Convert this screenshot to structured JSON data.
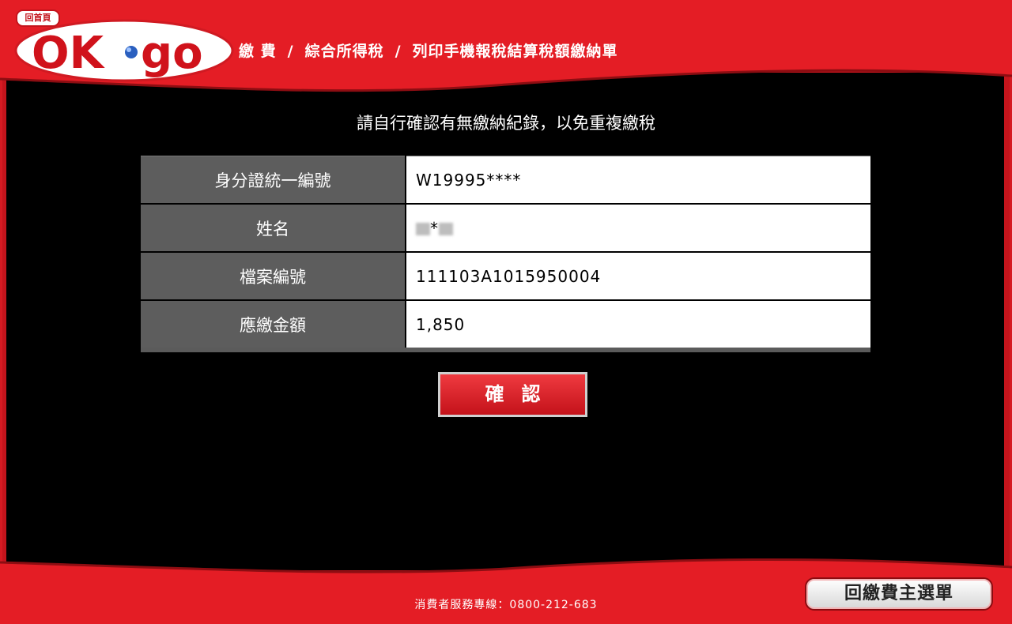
{
  "header": {
    "home_badge": "回首頁",
    "logo_text_left": "OK",
    "logo_text_right": "go",
    "breadcrumb": [
      "繳 費",
      "綜合所得稅",
      "列印手機報稅結算稅額繳納單"
    ],
    "breadcrumb_separator": "/"
  },
  "main": {
    "notice": "請自行確認有無繳納紀錄，以免重複繳稅",
    "rows": [
      {
        "label": "身分證統一編號",
        "value": "W19995****"
      },
      {
        "label": "姓名",
        "value": "*"
      },
      {
        "label": "檔案編號",
        "value": "111103A1015950004"
      },
      {
        "label": "應繳金額",
        "value": "1,850"
      }
    ],
    "confirm_label": "確認"
  },
  "footer": {
    "hotline": "消費者服務專線：0800-212-683",
    "menu_button": "回繳費主選單"
  },
  "colors": {
    "brand_red": "#c4141c",
    "label_gray": "#5d5d5d",
    "background": "#000000"
  }
}
